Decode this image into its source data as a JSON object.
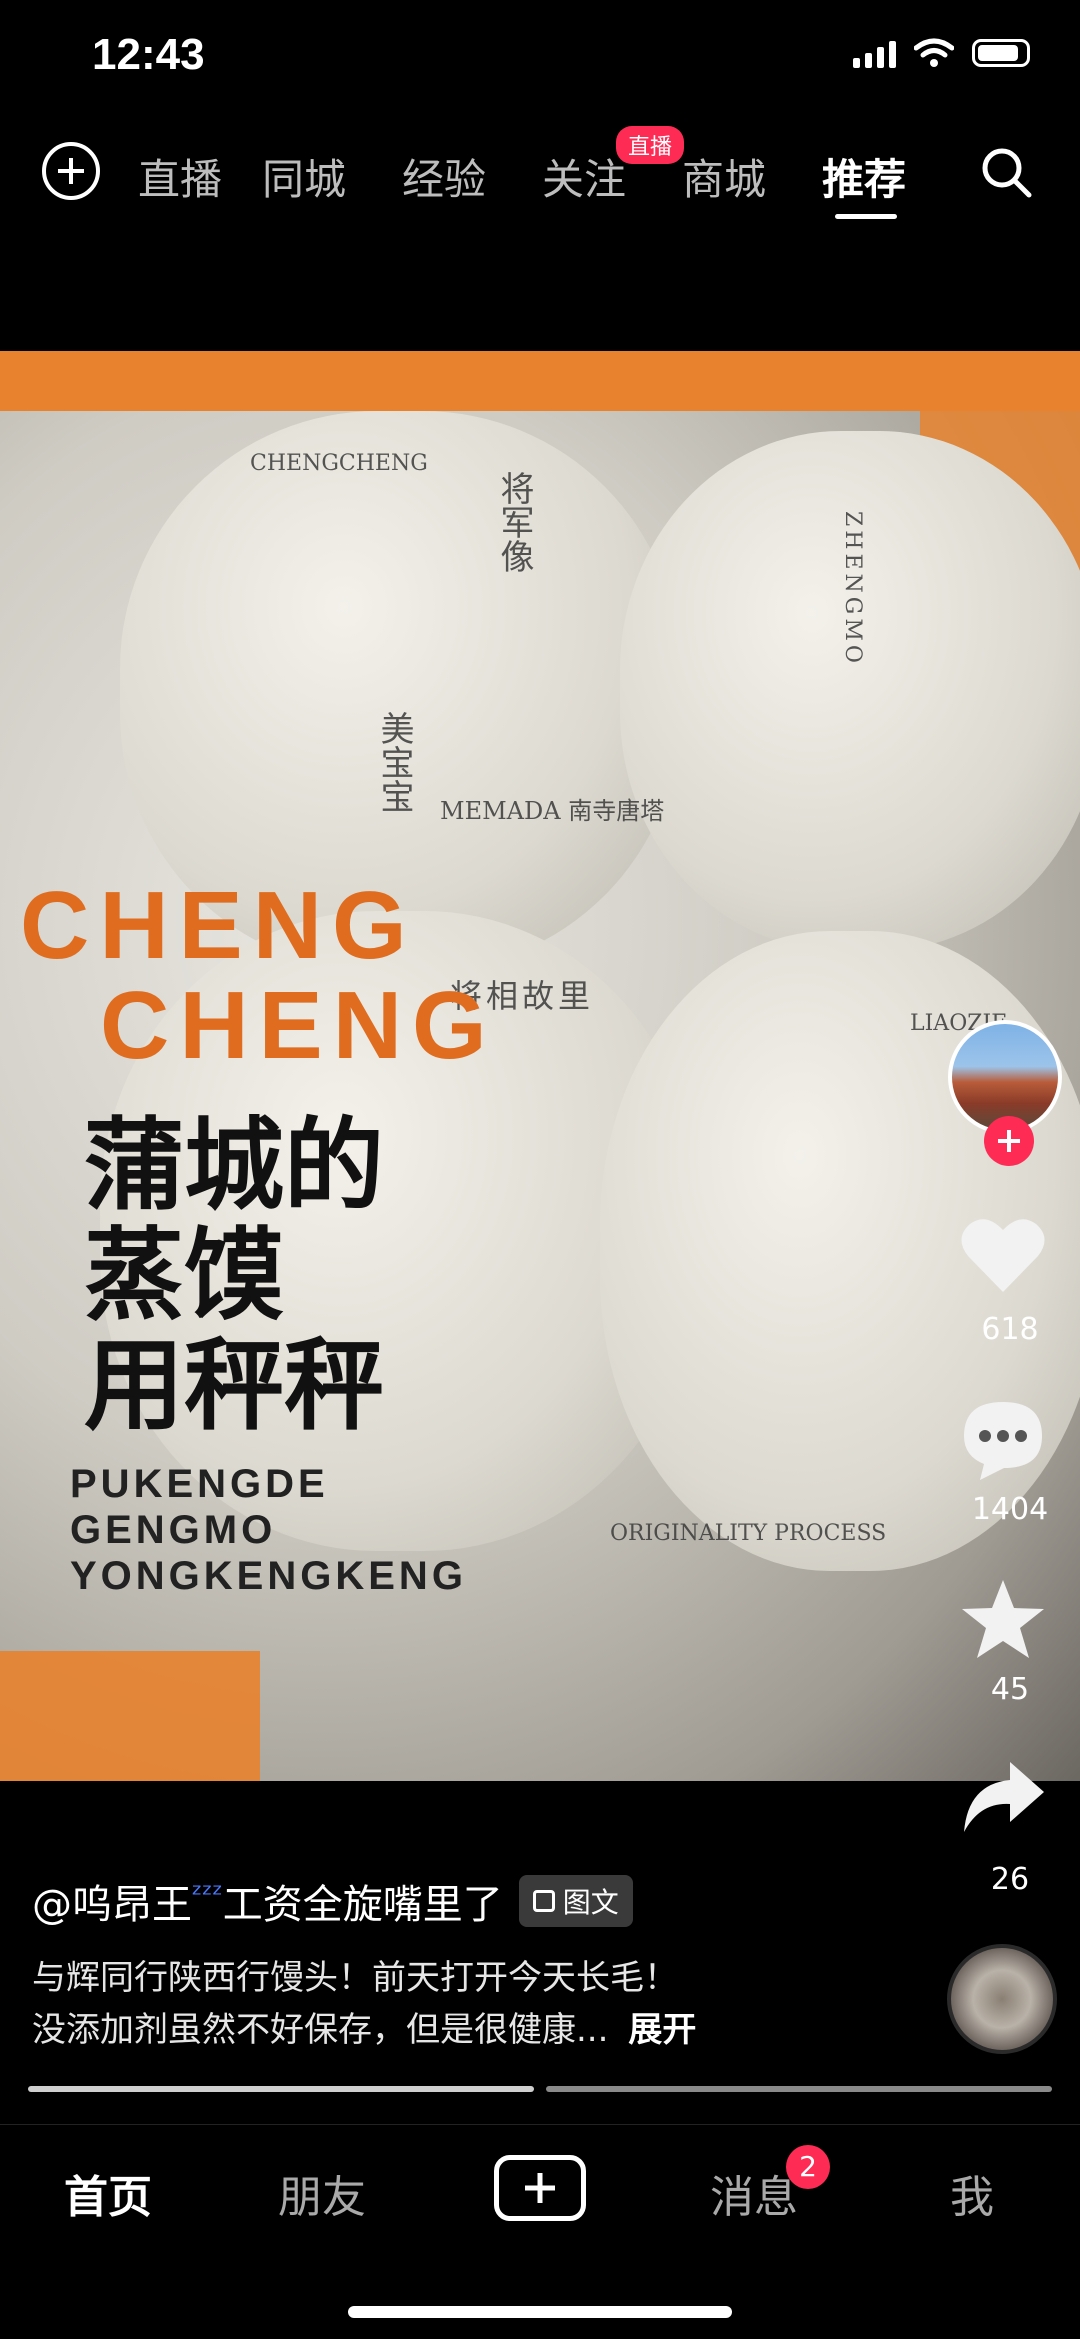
{
  "status_bar": {
    "time": "12:43"
  },
  "top_nav": {
    "tabs": [
      "直播",
      "同城",
      "经验",
      "关注",
      "商城",
      "推荐"
    ],
    "active_tab": "推荐",
    "live_badge": "直播"
  },
  "media": {
    "print_text": {
      "brand_line1": "CHENG",
      "brand_line2": "CHENG",
      "slogan_cn": [
        "蒲城的",
        "蒸馍",
        "用秤秤"
      ],
      "slogan_latin": [
        "PUKENGDE",
        "GENGMO",
        "YONGKENGKENG"
      ],
      "small_top": "CHENGCHENG",
      "small_a": "将军像",
      "small_b": "美宝宝",
      "small_c": "MEMADA 南寺唐塔",
      "small_d": "ORIGINALITY PROCESS",
      "small_e": "将相故里",
      "small_f": "ZHENGMO",
      "small_g": "LIAOZIE"
    }
  },
  "side_rail": {
    "likes": "618",
    "comments": "1404",
    "favorites": "45",
    "shares": "26"
  },
  "caption": {
    "author": "@呜昂王",
    "author_suffix": "工资全旋嘴里了",
    "tag": "图文",
    "line1": "与辉同行陕西行馒头！前天打开今天长毛！",
    "line2": "没添加剂虽然不好保存，但是很健康...",
    "expand": "展开"
  },
  "bottom_nav": {
    "home": "首页",
    "friends": "朋友",
    "messages": "消息",
    "messages_badge": "2",
    "me": "我"
  }
}
